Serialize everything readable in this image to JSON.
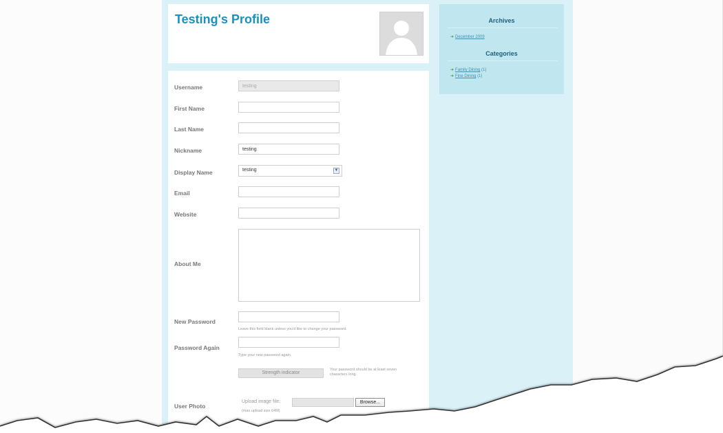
{
  "profile": {
    "title": "Testing's Profile"
  },
  "form": {
    "username": {
      "label": "Username",
      "value": "testing"
    },
    "first_name": {
      "label": "First Name",
      "value": ""
    },
    "last_name": {
      "label": "Last Name",
      "value": ""
    },
    "nickname": {
      "label": "Nickname",
      "value": "testing"
    },
    "display_name": {
      "label": "Display Name",
      "value": "testing"
    },
    "email": {
      "label": "Email",
      "value": ""
    },
    "website": {
      "label": "Website",
      "value": ""
    },
    "about_me": {
      "label": "About Me",
      "value": ""
    },
    "new_password": {
      "label": "New Password",
      "value": "",
      "hint": "Leave this field blank unless you'd like to change your password."
    },
    "password_again": {
      "label": "Password Again",
      "value": "",
      "hint": "Type your new password again."
    },
    "strength": {
      "label": "Strength indicator",
      "note": "Your password should be at least seven characters long."
    },
    "user_photo": {
      "label": "User Photo",
      "upload_label": "Upload image file:",
      "browse_label": "Browse...",
      "max_size": "(max upload size 64M)"
    }
  },
  "sidebar": {
    "archives_title": "Archives",
    "archives": [
      {
        "label": "December 2009",
        "count": ""
      }
    ],
    "categories_title": "Categories",
    "categories": [
      {
        "label": "Family Dining",
        "count": "(1)"
      },
      {
        "label": "Fine Dining",
        "count": "(1)"
      }
    ]
  },
  "colors": {
    "accent": "#1c8fbf",
    "column_bg": "#d9f1f7",
    "sidebar_box": "#c0e6ef",
    "link": "#3d8fb0",
    "link_arrow": "#3a9a3a"
  }
}
